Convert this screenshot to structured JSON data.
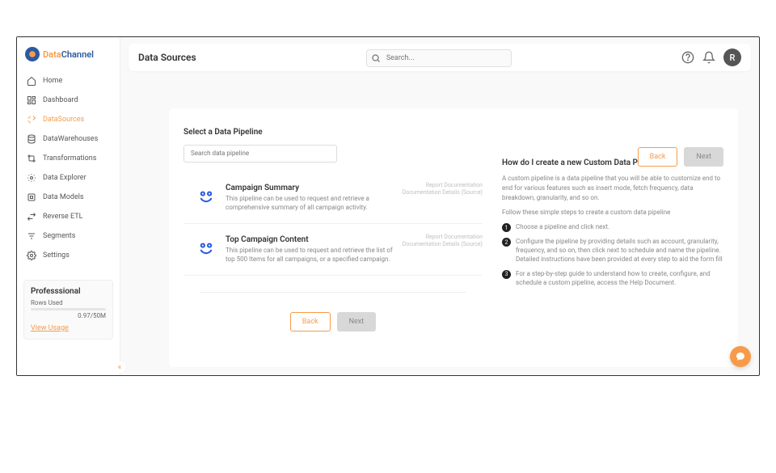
{
  "brand": {
    "part1": "Data",
    "part2": "Channel"
  },
  "sidebar": {
    "items": [
      {
        "label": "Home"
      },
      {
        "label": "Dashboard"
      },
      {
        "label": "DataSources"
      },
      {
        "label": "DataWarehouses"
      },
      {
        "label": "Transformations"
      },
      {
        "label": "Data Explorer"
      },
      {
        "label": "Data Models"
      },
      {
        "label": "Reverse ETL"
      },
      {
        "label": "Segments"
      },
      {
        "label": "Settings"
      }
    ],
    "plan": {
      "name": "Professsional",
      "rows_label": "Rows Used",
      "rows_value": "0.97/50M",
      "usage_link": "View Usage"
    }
  },
  "header": {
    "title": "Data Sources",
    "search_placeholder": "Search...",
    "avatar_initial": "R"
  },
  "main": {
    "section_label": "Select a Data Pipeline",
    "search_placeholder": "Search data pipeline",
    "back_label": "Back",
    "next_label": "Next",
    "pipelines": [
      {
        "title": "Campaign Summary",
        "desc": "This pipeline can be used to request and retrieve a comprehensive summary of all campaign activity.",
        "meta1": "Report Documentation",
        "meta2": "Documentation Details (Source)"
      },
      {
        "title": "Top Campaign Content",
        "desc": "This pipeline can be used to request and retrieve the list of top 500 Items for all campaigns, or a specified campaign.",
        "meta1": "Report Documentation",
        "meta2": "Documentation Details (Source)"
      }
    ]
  },
  "help": {
    "title": "How do I create a new Custom Data Pipeline?",
    "intro": "A custom pipeline is a data pipeline that you will be able to customize end to end for various features such as insert mode, fetch frequency, data breakdown, granularity, and so on.",
    "follow": "Follow these simple steps to create a custom data pipeline",
    "steps": [
      "Choose a pipeline and click next.",
      "Configure the pipeline by providing details such as account, granularity, frequency, and so on, then click next to schedule and name the pipeline. Detailed instructions have been provided at every step to aid the form fill",
      "For a step-by-step guide to understand how to create, configure, and schedule a custom pipeline, access the Help Document."
    ]
  }
}
